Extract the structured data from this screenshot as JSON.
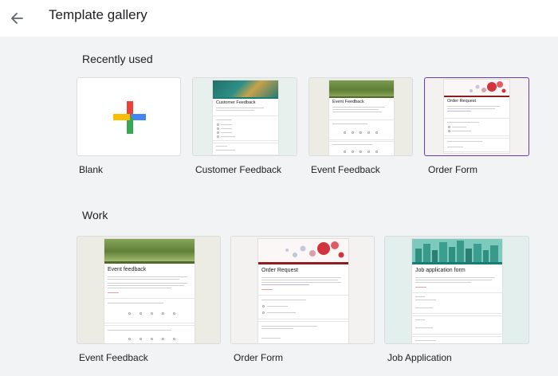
{
  "header": {
    "title": "Template gallery",
    "back_icon": "arrow-left-icon"
  },
  "sections": {
    "recent": {
      "title": "Recently used"
    },
    "work": {
      "title": "Work"
    }
  },
  "recent_templates": [
    {
      "label": "Blank"
    },
    {
      "label": "Customer Feedback",
      "thumb_title": "Customer Feedback"
    },
    {
      "label": "Event Feedback",
      "thumb_title": "Event Feedback"
    },
    {
      "label": "Order Form",
      "thumb_title": "Order Request"
    }
  ],
  "work_templates": [
    {
      "label": "Event Feedback",
      "thumb_title": "Event feedback"
    },
    {
      "label": "Order Form",
      "thumb_title": "Order Request"
    },
    {
      "label": "Job Application",
      "thumb_title": "Job application form"
    }
  ],
  "colors": {
    "plus_red": "#ea4335",
    "plus_blue": "#4285f4",
    "plus_yellow": "#fbbc04",
    "plus_green": "#34a853",
    "selected_border": "#673ab7"
  }
}
